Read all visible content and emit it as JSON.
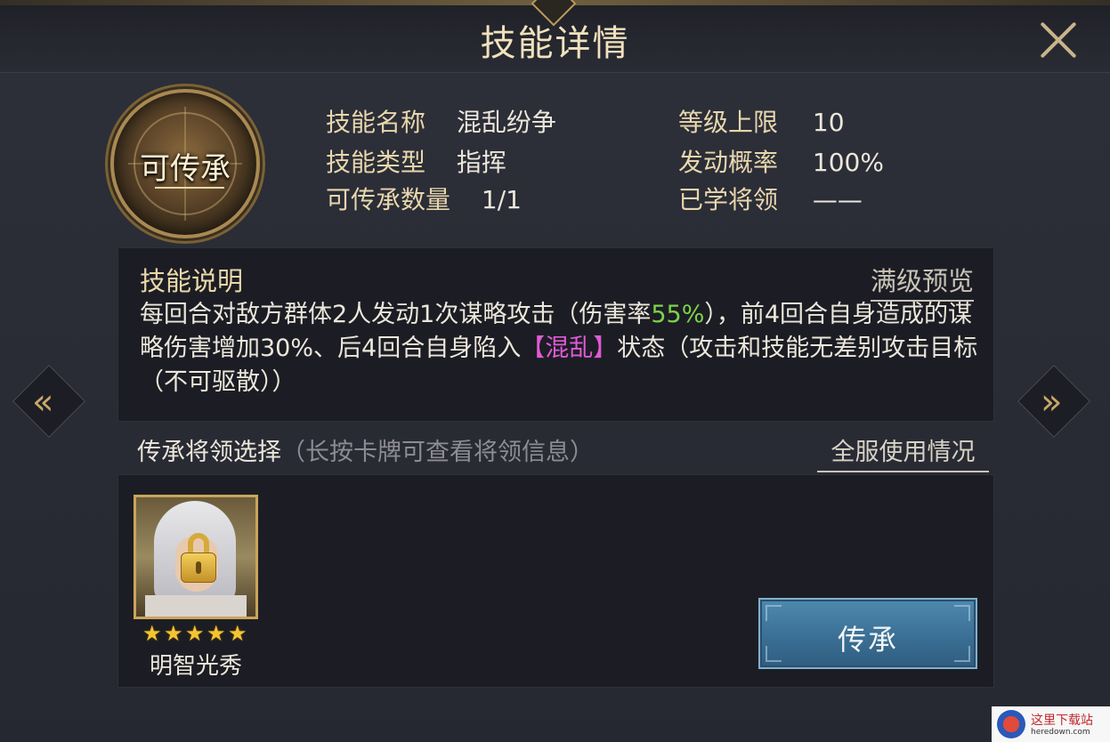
{
  "dialog": {
    "title": "技能详情"
  },
  "emblem": {
    "label": "可传承"
  },
  "info": {
    "name_label": "技能名称",
    "name_value": "混乱纷争",
    "type_label": "技能类型",
    "type_value": "指挥",
    "count_label": "可传承数量",
    "count_value": "1/1",
    "level_label": "等级上限",
    "level_value": "10",
    "rate_label": "发动概率",
    "rate_value": "100%",
    "learned_label": "已学将领",
    "learned_value": "——"
  },
  "description": {
    "heading": "技能说明",
    "preview_link": "满级预览",
    "part1": "每回合对敌方群体2人发动1次谋略攻击（伤害率",
    "highlight_rate": "55%",
    "part2": "），前4回合自身造成的谋略伤害增加30%、后4回合自身陷入",
    "highlight_status": "【混乱】",
    "part3": "状态（攻击和技能无差别攻击目标（不可驱散））",
    "colors": {
      "rate": "#7dd34b",
      "status": "#e05ad7"
    }
  },
  "inherit": {
    "title": "传承将领选择",
    "hint": "（长按卡牌可查看将领信息）",
    "server_link": "全服使用情况",
    "button_label": "传承"
  },
  "general": {
    "name": "明智光秀",
    "stars": 5,
    "locked": true
  },
  "nav": {
    "prev_icon": "chevron-left-icon",
    "next_icon": "chevron-right-icon"
  },
  "watermark": {
    "text": "这里下载站",
    "sub": "heredown.com"
  }
}
